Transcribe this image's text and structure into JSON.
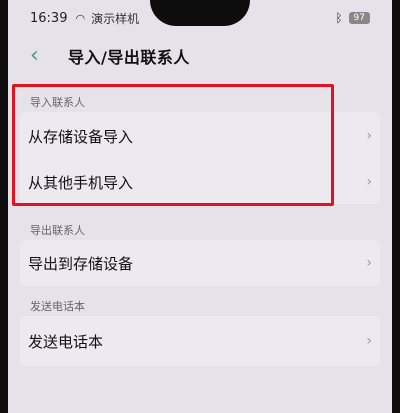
{
  "status": {
    "time": "16:39",
    "carrier": "演示样机",
    "battery": "97"
  },
  "header": {
    "back_icon": "chevron-left-icon",
    "title": "导入/导出联系人"
  },
  "sections": [
    {
      "label": "导入联系人",
      "items": [
        {
          "label": "从存储设备导入"
        },
        {
          "label": "从其他手机导入"
        }
      ]
    },
    {
      "label": "导出联系人",
      "items": [
        {
          "label": "导出到存储设备"
        }
      ]
    },
    {
      "label": "发送电话本",
      "items": [
        {
          "label": "发送电话本"
        }
      ]
    }
  ],
  "colors": {
    "accent": "#4a9a8a",
    "highlight": "#e0141e",
    "background": "#e6e2ea"
  }
}
